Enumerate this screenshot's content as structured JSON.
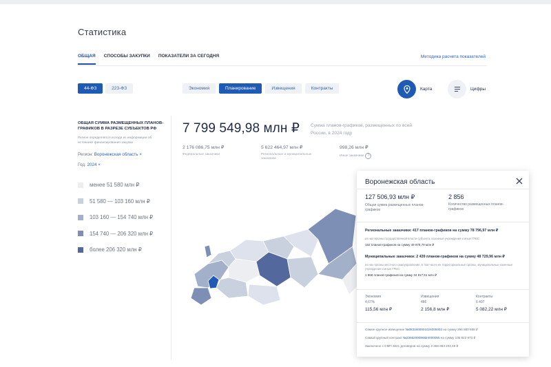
{
  "page": {
    "title": "Статистика"
  },
  "tabs": [
    {
      "label": "ОБЩАЯ",
      "active": true
    },
    {
      "label": "СПОСОБЫ ЗАКУПКИ",
      "active": false
    },
    {
      "label": "ПОКАЗАТЕЛИ ЗА СЕГОДНЯ",
      "active": false
    }
  ],
  "method_link": "Методика расчета показателей",
  "law_buttons": [
    {
      "label": "44-ФЗ",
      "active": true
    },
    {
      "label": "223-ФЗ",
      "active": false
    }
  ],
  "filters": [
    {
      "label": "Экономия",
      "active": false
    },
    {
      "label": "Планирование",
      "active": true
    },
    {
      "label": "Извещения",
      "active": false
    },
    {
      "label": "Контракты",
      "active": false
    }
  ],
  "view_toggle": {
    "map_label": "Карта",
    "map_icon": "location-pin-icon",
    "numbers_label": "Цифры",
    "numbers_icon": "list-lines-icon"
  },
  "sidebar": {
    "title": "Общая сумма размещенных планов-графиков в разрезе субъектов РФ",
    "note": "Регион определяется исходя из информации об источнике финансирования закупки",
    "region_label": "Регион:",
    "region_value": "Воронежская область ×",
    "year_label": "Год:",
    "year_value": "2024 ×",
    "legend": [
      {
        "label": "менее 51 580 млн ₽",
        "color": "#eceef2"
      },
      {
        "label": "51 580 — 103 160 млн ₽",
        "color": "#c9d0de"
      },
      {
        "label": "103 160 — 154 740 млн ₽",
        "color": "#a3b0c9"
      },
      {
        "label": "154 740 — 206 320 млн ₽",
        "color": "#7d8fb5"
      },
      {
        "label": "более 206 320 млн ₽",
        "color": "#53699e"
      }
    ]
  },
  "main": {
    "total_value": "7 799 549,98 млн ₽",
    "total_note": "Сумма планов-графиков, размещенных по всей России, в 2024 году",
    "sub_stats": [
      {
        "value": "2 176 086,75 млн ₽",
        "label": "Федеральные заказчики"
      },
      {
        "value": "5 622 464,97 млн ₽",
        "label": "Региональные и муниципальные заказчики"
      },
      {
        "value": "998,26 млн ₽",
        "label": "Иные заказчики"
      }
    ]
  },
  "popup": {
    "title": "Воронежская область",
    "stat1_value": "127 506,93 млн ₽",
    "stat1_label": "Общая сумма размещенных планов-графиков",
    "stat2_value": "2 856",
    "stat2_label": "Количество размещенных планов-графиков",
    "regional_head": "Региональные заказчики: 417 планов-графиков на сумму 78 796,97 млн ₽",
    "regional_desc": "из них органы государственной власти субъекта, казенные учреждения и иные ГРБС:",
    "regional_sub": "152 планов-графиков на сумму 49 978,79 млн ₽",
    "municipal_head": "Муниципальные заказчики: 2 439 планов-графиков на сумму 48 729,96 млн ₽",
    "municipal_desc": "из них органы местного самоуправления, в том числе их территориальные органы, муниципальные казенные учреждения и иные ГРБС:",
    "municipal_sub": "1 868 планов-графиков на сумму 34 817,51 млн ₽",
    "cols": [
      {
        "l1": "Экономия",
        "l2": "4,67%",
        "l3": "115,56 млн ₽"
      },
      {
        "l1": "Извещения",
        "l2": "486",
        "l3": "2 156,8 млн ₽"
      },
      {
        "l1": "Контракты",
        "l2": "6 497",
        "l3": "5 082,22 млн ₽"
      }
    ],
    "foot1_pre": "Самое крупное извещение",
    "foot1_link": "№0831600001024000002",
    "foot1_post": "на сумму 296 880 688 ₽",
    "foot2_pre": "Самый крупный контракт",
    "foot2_link": "№2366200086824000055",
    "foot2_post": "на сумму 105 822 973 ₽",
    "foot3": "Заключено с СМП 3821 договоров на сумму 2 388 683 203,49 ₽"
  }
}
